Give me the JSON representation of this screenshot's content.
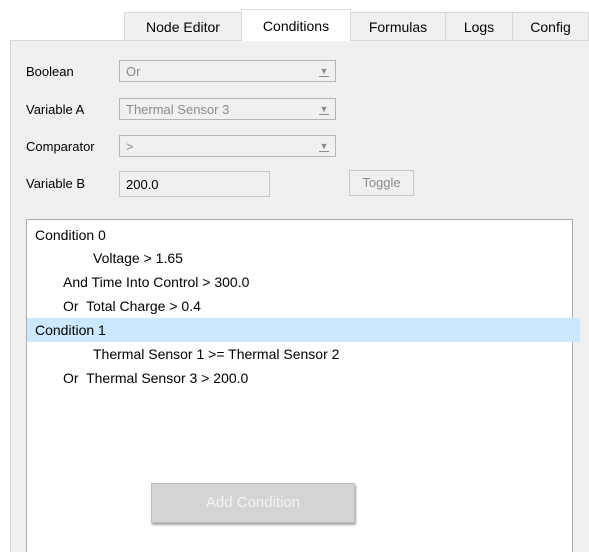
{
  "tabs": [
    "Node Editor",
    "Conditions",
    "Formulas",
    "Logs",
    "Config"
  ],
  "active_tab": "Conditions",
  "form": {
    "boolean_label": "Boolean",
    "boolean_value": "Or",
    "variable_a_label": "Variable A",
    "variable_a_value": "Thermal Sensor 3",
    "comparator_label": "Comparator",
    "comparator_value": ">",
    "variable_b_label": "Variable B",
    "variable_b_value": "200.0",
    "toggle_label": "Toggle"
  },
  "conditions": [
    "Condition 0",
    "Voltage > 1.65",
    "And Time Into Control > 300.0",
    "Or  Total Charge > 0.4",
    "Condition 1",
    "Thermal Sensor 1 >= Thermal Sensor 2",
    "Or  Thermal Sensor 3 > 200.0"
  ],
  "selected_condition": "Condition 1",
  "add_condition_label": "Add Condition",
  "colors": {
    "selection": "#cce8ff",
    "panel": "#f0f0f0"
  }
}
